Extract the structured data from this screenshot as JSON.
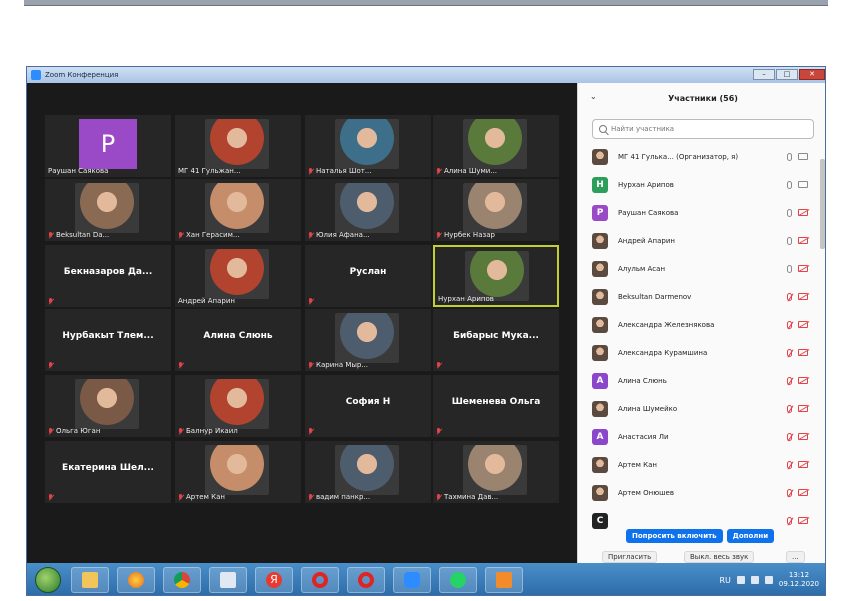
{
  "window": {
    "title": "Zoom Конференция"
  },
  "colors": {
    "accent": "#0e72ed",
    "active_speaker": "#c3d12c",
    "muted": "#e0434a"
  },
  "gallery": {
    "tiles": [
      {
        "name": "Раушан Саякова",
        "type": "letter",
        "letter": "P",
        "muted": false
      },
      {
        "name": "МГ 41 Гульжан...",
        "type": "video",
        "muted": false
      },
      {
        "name": "Наталья Шот...",
        "type": "video",
        "muted": true
      },
      {
        "name": "Алина Шуми...",
        "type": "video",
        "muted": true
      },
      {
        "name": "Beksultan Da...",
        "type": "video",
        "muted": true
      },
      {
        "name": "Хан Герасим...",
        "type": "video",
        "muted": true
      },
      {
        "name": "Юлия Афана...",
        "type": "video",
        "muted": true
      },
      {
        "name": "Нурбек Назар",
        "type": "video",
        "muted": true
      },
      {
        "name": "Бекназаров Да...",
        "type": "name",
        "muted": true
      },
      {
        "name": "Андрей Апарин",
        "type": "video",
        "muted": false
      },
      {
        "name": "Руслан",
        "type": "name",
        "muted": true
      },
      {
        "name": "Нурхан Арипов",
        "type": "video",
        "muted": false,
        "active": true
      },
      {
        "name": "Нурбакыт Тлем...",
        "type": "name",
        "muted": true
      },
      {
        "name": "Алина Слюнь",
        "type": "name",
        "muted": true
      },
      {
        "name": "Карина Мыр...",
        "type": "video",
        "muted": true
      },
      {
        "name": "Бибарыс Мука...",
        "type": "name",
        "muted": true
      },
      {
        "name": "Ольга Юган",
        "type": "video",
        "muted": true
      },
      {
        "name": "Балнур Икаил",
        "type": "video",
        "muted": true
      },
      {
        "name": "София Н",
        "type": "name",
        "muted": true
      },
      {
        "name": "Шеменева Ольга",
        "type": "name",
        "muted": true
      },
      {
        "name": "Екатерина Шел...",
        "type": "name",
        "muted": true
      },
      {
        "name": "Артем Кан",
        "type": "video",
        "muted": true
      },
      {
        "name": "вадим панкр...",
        "type": "video",
        "muted": true
      },
      {
        "name": "Тахмина Дав...",
        "type": "video",
        "muted": true
      }
    ]
  },
  "participants": {
    "title": "Участники (56)",
    "search_placeholder": "Найти участника",
    "items": [
      {
        "name": "МГ 41 Гулька... (Организатор, я)",
        "avatar": "photo",
        "mic": "on",
        "cam": "on"
      },
      {
        "name": "Нурхан Арипов",
        "avatar": "H",
        "avatar_color": "#2e9e5b",
        "mic": "on",
        "cam": "on"
      },
      {
        "name": "Раушан Саякова",
        "avatar": "P",
        "avatar_color": "#9a4ac6",
        "mic": "on",
        "cam": "off"
      },
      {
        "name": "Андрей Апарин",
        "avatar": "photo",
        "mic": "on",
        "cam": "off"
      },
      {
        "name": "Алульм Асан",
        "avatar": "photo",
        "mic": "on",
        "cam": "off"
      },
      {
        "name": "Beksultan Darmenov",
        "avatar": "photo",
        "mic": "off",
        "cam": "off"
      },
      {
        "name": "Александра Железнякова",
        "avatar": "photo",
        "mic": "off",
        "cam": "off"
      },
      {
        "name": "Александра Курамшина",
        "avatar": "photo",
        "mic": "off",
        "cam": "off"
      },
      {
        "name": "Алина Слюнь",
        "avatar": "A",
        "avatar_color": "#8b47c9",
        "mic": "off",
        "cam": "off"
      },
      {
        "name": "Алина Шумейко",
        "avatar": "photo",
        "mic": "off",
        "cam": "off"
      },
      {
        "name": "Анастасия Ли",
        "avatar": "A",
        "avatar_color": "#8b47c9",
        "mic": "off",
        "cam": "off"
      },
      {
        "name": "Артем Кан",
        "avatar": "photo",
        "mic": "off",
        "cam": "off"
      },
      {
        "name": "Артем Онюшев",
        "avatar": "photo",
        "mic": "off",
        "cam": "off"
      },
      {
        "name": "",
        "avatar": "C",
        "avatar_color": "#222222",
        "mic": "off",
        "cam": "off"
      }
    ],
    "ask_unmute_label": "Попросить включить",
    "more_label": "Дополни",
    "invite_label": "Пригласить",
    "mute_all_label": "Выкл. весь звук",
    "ellipsis_label": "..."
  },
  "taskbar": {
    "lang": "RU",
    "clock_time": "13:12",
    "clock_date": "09.12.2020"
  }
}
